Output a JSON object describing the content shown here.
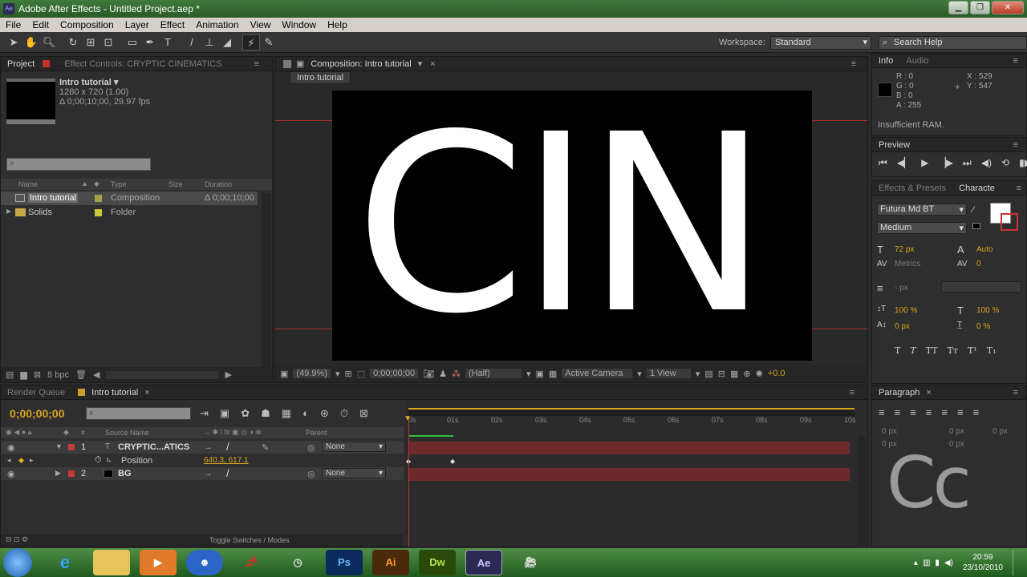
{
  "window": {
    "title": "Adobe After Effects - Untitled Project.aep *",
    "app_icon": "Ae"
  },
  "menu": [
    "File",
    "Edit",
    "Composition",
    "Layer",
    "Effect",
    "Animation",
    "View",
    "Window",
    "Help"
  ],
  "toolbar": {
    "tools": [
      "selection-tool-icon",
      "hand-tool-icon",
      "zoom-tool-icon",
      "rotate-tool-icon",
      "camera-orbit-icon",
      "pan-behind-icon",
      "rectangle-tool-icon",
      "pen-tool-icon",
      "type-tool-icon",
      "brush-tool-icon",
      "clone-stamp-icon",
      "eraser-icon",
      "roto-brush-icon",
      "puppet-pin-icon"
    ],
    "workspace_label": "Workspace:",
    "workspace_value": "Standard",
    "search_placeholder": "Search Help"
  },
  "project": {
    "tabs": [
      "Project",
      "Effect Controls: CRYPTIC CINEMATICS"
    ],
    "selected_name": "Intro tutorial ▾",
    "selected_info1": "1280 x 720 (1.00)",
    "selected_info2": "Δ 0;00;10;00, 29.97 fps",
    "columns": [
      "Name",
      "Type",
      "Size",
      "Duration"
    ],
    "items": [
      {
        "name": "Intro tutorial",
        "type": "Composition",
        "duration": "Δ 0;00;10;00",
        "label_color": "#a7a145"
      },
      {
        "name": "Solids",
        "type": "Folder",
        "duration": "",
        "label_color": "#c8c83a"
      }
    ],
    "bpc": "8 bpc"
  },
  "composition": {
    "tab": "Composition: Intro tutorial",
    "breadcrumb": "Intro tutorial",
    "text": "CIN",
    "zoom": "(49.9%)",
    "timecode": "0;00;00;00",
    "resolution": "(Half)",
    "camera": "Active Camera",
    "views": "1 View",
    "exposure": "+0.0"
  },
  "info": {
    "tabs": [
      "Info",
      "Audio"
    ],
    "r": "R : 0",
    "g": "G : 0",
    "b": "B : 0",
    "a": "A : 255",
    "x": "X : 529",
    "y": "Y : 547",
    "warning": "Insufficient RAM."
  },
  "preview": {
    "tab": "Preview"
  },
  "character": {
    "tabs": [
      "Effects & Presets",
      "Characte"
    ],
    "font": "Futura Md BT",
    "style": "Medium",
    "size": "72 px",
    "leading": "Auto",
    "kerning": "Metrics",
    "tracking": "0",
    "stroke": "- px",
    "vscale": "100 %",
    "hscale": "100 %",
    "baseline": "0 px",
    "tsume": "0 %",
    "styles": [
      "T",
      "T",
      "TT",
      "Tт",
      "T¹",
      "T₁"
    ]
  },
  "paragraph": {
    "tab": "Paragraph",
    "values": [
      "0 px",
      "0 px",
      "0 px",
      "0 px",
      "0 px"
    ]
  },
  "watermark": "Cc",
  "timeline": {
    "tabs": [
      "Render Queue",
      "Intro tutorial"
    ],
    "timecode": "0;00;00;00",
    "columns": {
      "source": "Source Name",
      "parent": "Parent"
    },
    "ruler": [
      "0s",
      "01s",
      "02s",
      "03s",
      "04s",
      "05s",
      "06s",
      "07s",
      "08s",
      "09s",
      "10s"
    ],
    "layers": [
      {
        "num": "1",
        "name": "CRYPTIC...ATICS",
        "parent": "None",
        "color": "#c23a3a"
      },
      {
        "num": "2",
        "name": "BG",
        "parent": "None",
        "color": "#c23a3a"
      }
    ],
    "position_label": "Position",
    "position_value": "640.3, 617.1",
    "toggle": "Toggle Switches / Modes"
  },
  "taskbar": {
    "apps": [
      "Ps",
      "Ai",
      "Dw",
      "Ae"
    ],
    "time": "20:59",
    "date": "23/10/2010"
  }
}
